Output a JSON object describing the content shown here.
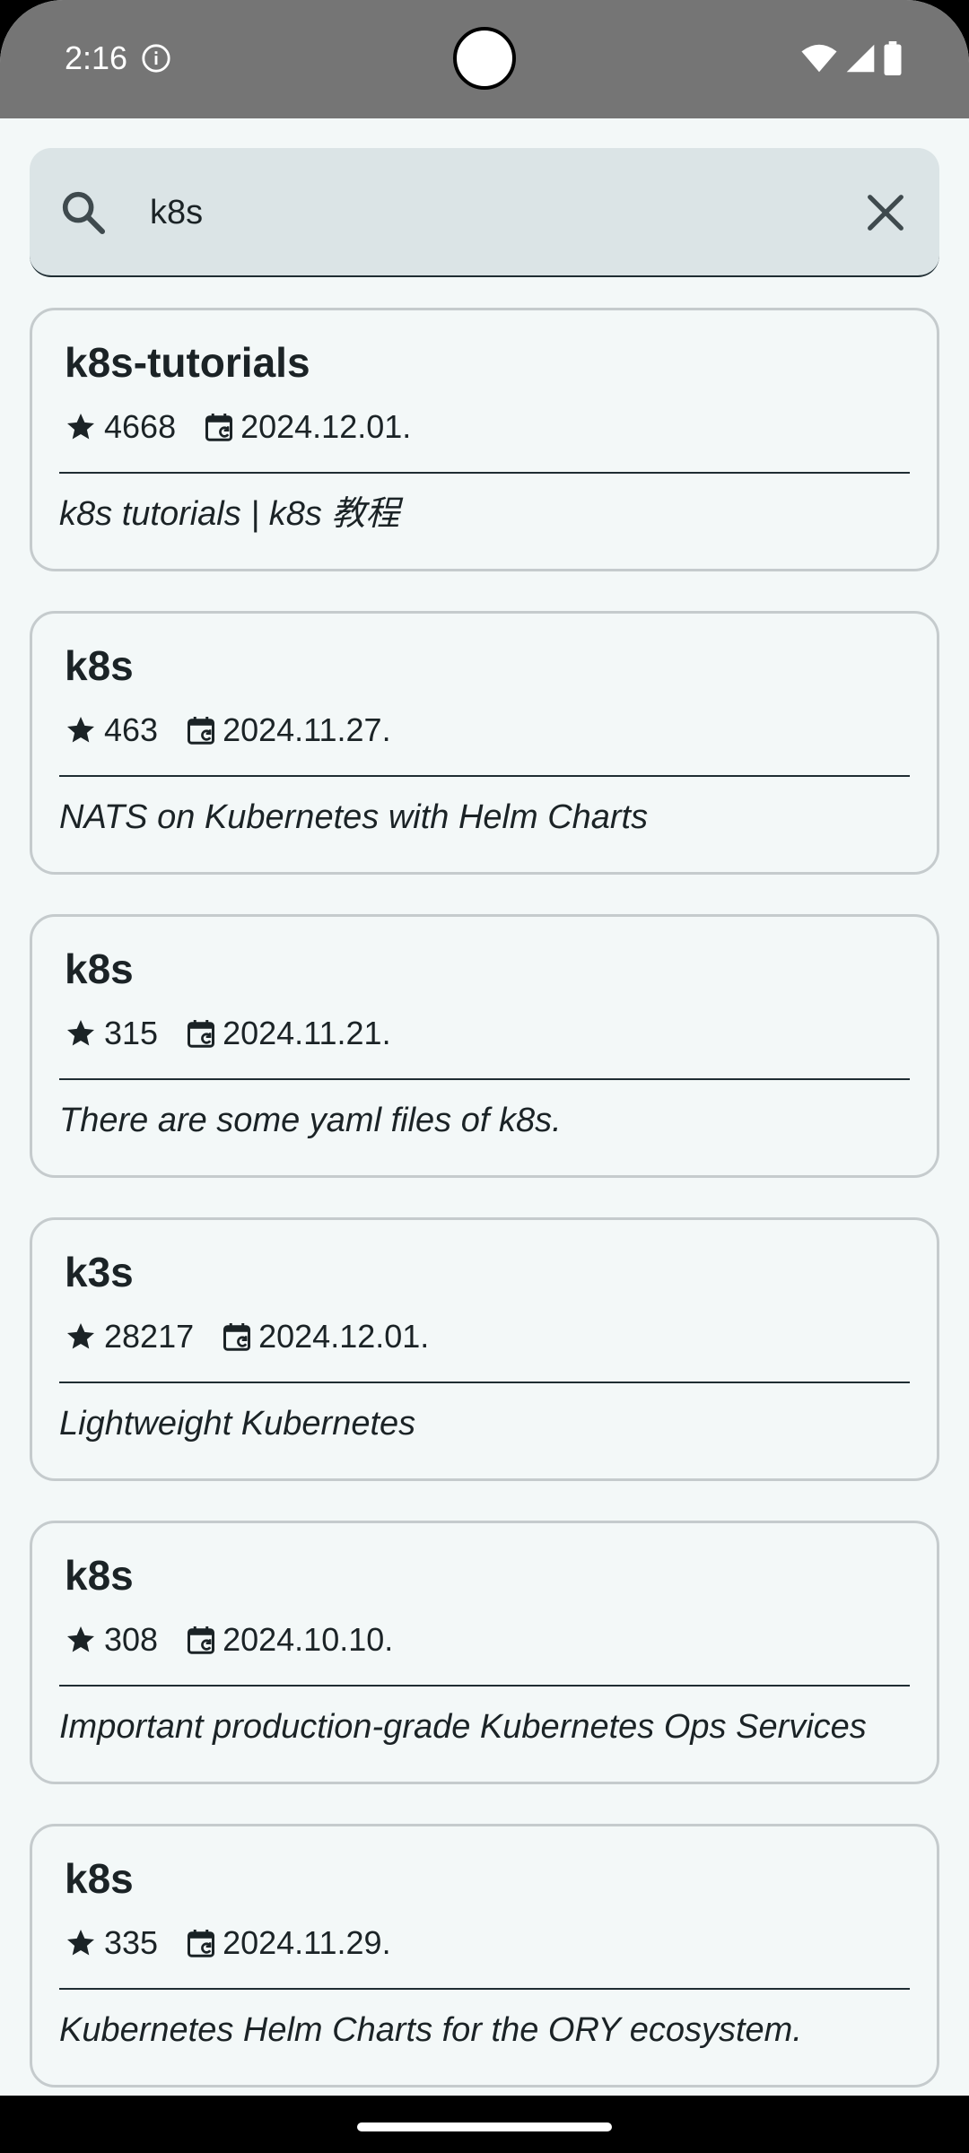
{
  "status_bar": {
    "time": "2:16"
  },
  "search": {
    "query": "k8s"
  },
  "results": [
    {
      "title": "k8s-tutorials",
      "stars": "4668",
      "date": "2024.12.01.",
      "description": "k8s tutorials | k8s 教程"
    },
    {
      "title": "k8s",
      "stars": "463",
      "date": "2024.11.27.",
      "description": "NATS on Kubernetes with Helm Charts"
    },
    {
      "title": "k8s",
      "stars": "315",
      "date": "2024.11.21.",
      "description": "There are some yaml files of k8s."
    },
    {
      "title": "k3s",
      "stars": "28217",
      "date": "2024.12.01.",
      "description": "Lightweight Kubernetes"
    },
    {
      "title": "k8s",
      "stars": "308",
      "date": "2024.10.10.",
      "description": "Important production-grade Kubernetes Ops Services"
    },
    {
      "title": "k8s",
      "stars": "335",
      "date": "2024.11.29.",
      "description": "Kubernetes Helm Charts for the ORY ecosystem."
    }
  ],
  "icons": {
    "status": [
      "info-icon",
      "wifi-icon",
      "signal-icon",
      "battery-icon"
    ],
    "search": "search-icon",
    "clear": "close-icon",
    "stars": "star-icon",
    "date": "calendar-update-icon"
  },
  "colors": {
    "background": "#f3f8f8",
    "status_bar": "#757575",
    "search_bar": "#dbe4e6",
    "text": "#1b2326",
    "card_border": "#c5cbcd"
  }
}
